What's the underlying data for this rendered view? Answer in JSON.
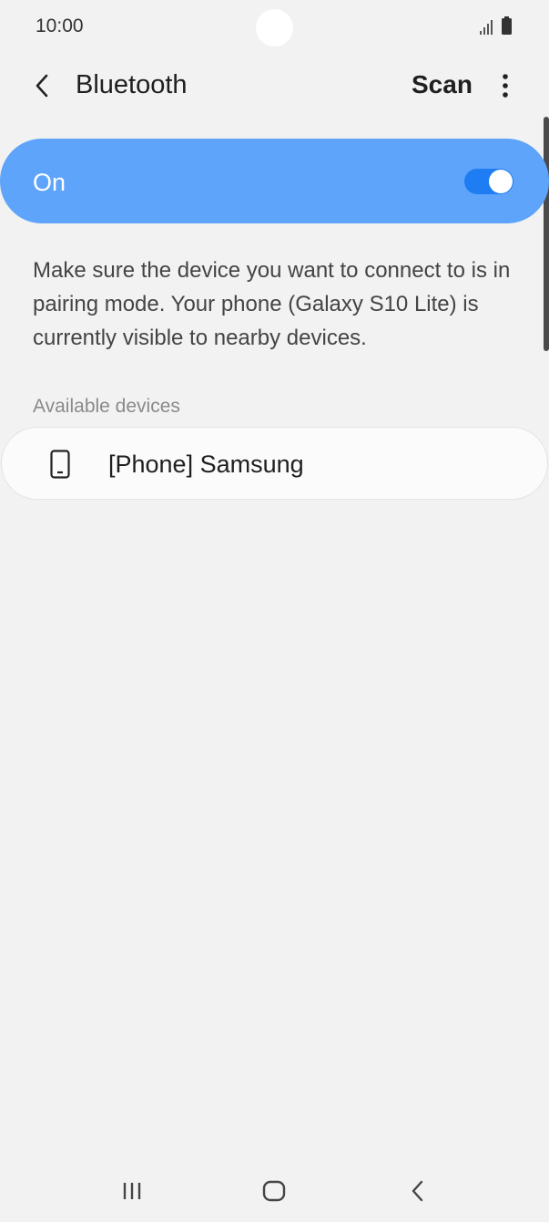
{
  "status_bar": {
    "time": "10:00",
    "icons": [
      "signal-icon",
      "battery-icon"
    ]
  },
  "app_bar": {
    "title": "Bluetooth",
    "scan_label": "Scan",
    "back_icon": "chevron-left-icon",
    "more_icon": "more-vert-icon"
  },
  "master_toggle": {
    "label": "On",
    "enabled": true,
    "accent_color": "#5ea4fb",
    "switch_color": "#1e7df2"
  },
  "info_text": "Make sure the device you want to connect to is in pairing mode. Your phone (Galaxy S10 Lite) is currently visible to nearby devices.",
  "available_devices": {
    "header": "Available devices",
    "items": [
      {
        "name": "[Phone] Samsung",
        "icon": "phone-icon"
      }
    ]
  },
  "nav_bar": {
    "items": [
      {
        "icon": "recents-icon"
      },
      {
        "icon": "home-icon"
      },
      {
        "icon": "back-icon"
      }
    ]
  }
}
